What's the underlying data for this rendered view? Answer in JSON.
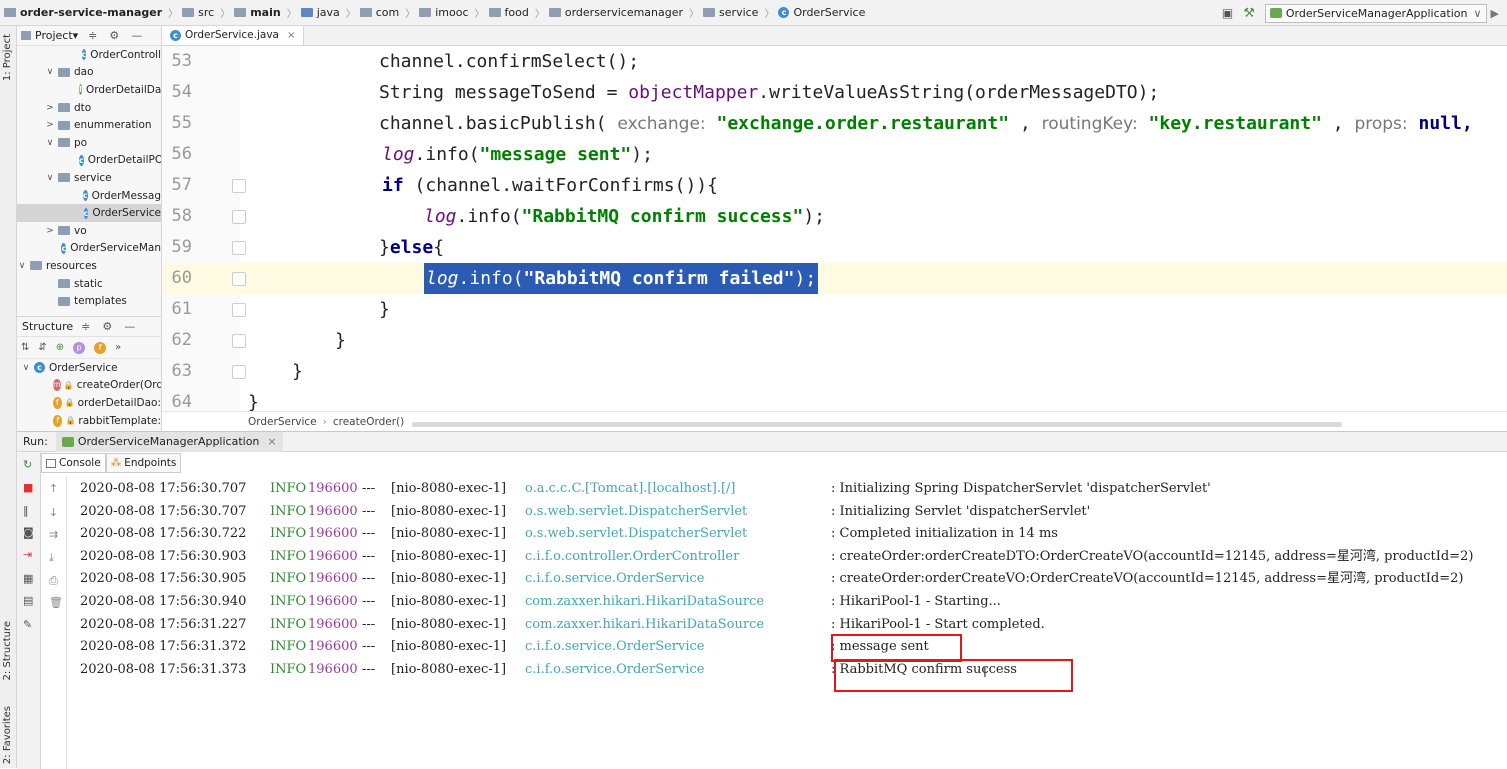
{
  "breadcrumb": {
    "items": [
      {
        "label": "order-service-manager",
        "icon": "module-folder-icon",
        "bold": true
      },
      {
        "label": "src",
        "icon": "folder-icon"
      },
      {
        "label": "main",
        "icon": "folder-icon",
        "bold": true
      },
      {
        "label": "java",
        "icon": "source-folder-icon"
      },
      {
        "label": "com",
        "icon": "folder-icon"
      },
      {
        "label": "imooc",
        "icon": "folder-icon"
      },
      {
        "label": "food",
        "icon": "folder-icon"
      },
      {
        "label": "orderservicemanager",
        "icon": "folder-icon"
      },
      {
        "label": "service",
        "icon": "folder-icon"
      },
      {
        "label": "OrderService",
        "icon": "class-icon"
      }
    ]
  },
  "run_config": {
    "label": "OrderServiceManagerApplication"
  },
  "left_strip": {
    "project_tab": "1: Project",
    "structure_tab": "2: Structure",
    "favorites_tab": "2: Favorites"
  },
  "project_panel": {
    "title": "Project",
    "items": [
      {
        "label": "OrderControll",
        "type": "class",
        "indent": 62,
        "arrow": ""
      },
      {
        "label": "dao",
        "type": "folder",
        "indent": 28,
        "arrow": "∨"
      },
      {
        "label": "OrderDetailDa",
        "type": "interface",
        "indent": 62,
        "arrow": ""
      },
      {
        "label": "dto",
        "type": "folder",
        "indent": 28,
        "arrow": ">"
      },
      {
        "label": "enummeration",
        "type": "folder",
        "indent": 28,
        "arrow": ">"
      },
      {
        "label": "po",
        "type": "folder",
        "indent": 28,
        "arrow": "∨"
      },
      {
        "label": "OrderDetailPO",
        "type": "class",
        "indent": 62,
        "arrow": ""
      },
      {
        "label": "service",
        "type": "folder",
        "indent": 28,
        "arrow": "∨"
      },
      {
        "label": "OrderMessag",
        "type": "class",
        "indent": 62,
        "arrow": ""
      },
      {
        "label": "OrderService",
        "type": "class",
        "indent": 62,
        "arrow": "",
        "selected": true
      },
      {
        "label": "vo",
        "type": "folder",
        "indent": 28,
        "arrow": ">"
      },
      {
        "label": "OrderServiceMan",
        "type": "class",
        "indent": 44,
        "arrow": ""
      },
      {
        "label": "resources",
        "type": "folder",
        "indent": 0,
        "arrow": "∨"
      },
      {
        "label": "static",
        "type": "folder",
        "indent": 28,
        "arrow": ""
      },
      {
        "label": "templates",
        "type": "folder",
        "indent": 28,
        "arrow": ""
      }
    ]
  },
  "structure_panel": {
    "title": "Structure",
    "root": "OrderService",
    "members": [
      {
        "label": "createOrder(Ord",
        "badge": "m",
        "color": "#d66b6b"
      },
      {
        "label": "orderDetailDao:",
        "badge": "f",
        "color": "#e5a12a"
      },
      {
        "label": "rabbitTemplate:",
        "badge": "f",
        "color": "#e5a12a"
      }
    ]
  },
  "editor": {
    "tab_label": "OrderService.java",
    "breadcrumb": [
      "OrderService",
      "createOrder()"
    ],
    "lines": [
      {
        "num": "53"
      },
      {
        "num": "54"
      },
      {
        "num": "55"
      },
      {
        "num": "56"
      },
      {
        "num": "57"
      },
      {
        "num": "58"
      },
      {
        "num": "59"
      },
      {
        "num": "60"
      },
      {
        "num": "61"
      },
      {
        "num": "62"
      },
      {
        "num": "63"
      },
      {
        "num": "64"
      }
    ],
    "code": {
      "l53": "channel.confirmSelect();",
      "l54a": "String messageToSend = ",
      "l54b": "objectMapper",
      "l54c": ".writeValueAsString(orderMessageDTO);",
      "l55a": "channel.basicPublish(",
      "l55h1": "exchange:",
      "l55s1": "\"exchange.order.restaurant\"",
      "l55c1": ",",
      "l55h2": "routingKey:",
      "l55s2": "\"key.restaurant\"",
      "l55c2": ",",
      "l55h3": "props:",
      "l55k": "null,",
      "l56a": "log",
      "l56b": ".info(",
      "l56s": "\"message sent\"",
      "l56c": ");",
      "l57a": "if",
      "l57b": " (channel.waitForConfirms()){",
      "l58a": "log",
      "l58b": ".info(",
      "l58s": "\"RabbitMQ confirm success\"",
      "l58c": ");",
      "l59a": "}",
      "l59b": "else",
      "l59c": "{",
      "l60a": "log",
      "l60b": ".info(",
      "l60s": "\"RabbitMQ confirm failed\"",
      "l60c": ");",
      "l61": "}",
      "l62": "}",
      "l63": "}",
      "l64": "}"
    }
  },
  "run_panel": {
    "label": "Run:",
    "tab": "OrderServiceManagerApplication",
    "console_tab": "Console",
    "endpoints_tab": "Endpoints",
    "log": [
      {
        "time": "2020-08-08 17:56:30.707",
        "level": "INFO",
        "pid": "196600",
        "sep": "---",
        "thread": "[nio-8080-exec-1]",
        "logger": "o.a.c.c.C.[Tomcat].[localhost].[/]",
        "message": ": Initializing Spring DispatcherServlet 'dispatcherServlet'"
      },
      {
        "time": "2020-08-08 17:56:30.707",
        "level": "INFO",
        "pid": "196600",
        "sep": "---",
        "thread": "[nio-8080-exec-1]",
        "logger": "o.s.web.servlet.DispatcherServlet",
        "message": ": Initializing Servlet 'dispatcherServlet'"
      },
      {
        "time": "2020-08-08 17:56:30.722",
        "level": "INFO",
        "pid": "196600",
        "sep": "---",
        "thread": "[nio-8080-exec-1]",
        "logger": "o.s.web.servlet.DispatcherServlet",
        "message": ": Completed initialization in 14 ms"
      },
      {
        "time": "2020-08-08 17:56:30.903",
        "level": "INFO",
        "pid": "196600",
        "sep": "---",
        "thread": "[nio-8080-exec-1]",
        "logger": "c.i.f.o.controller.OrderController",
        "message": ": createOrder:orderCreateDTO:OrderCreateVO(accountId=12145, address=星河湾, productId=2)"
      },
      {
        "time": "2020-08-08 17:56:30.905",
        "level": "INFO",
        "pid": "196600",
        "sep": "---",
        "thread": "[nio-8080-exec-1]",
        "logger": "c.i.f.o.service.OrderService",
        "message": ": createOrder:orderCreateVO:OrderCreateVO(accountId=12145, address=星河湾, productId=2)"
      },
      {
        "time": "2020-08-08 17:56:30.940",
        "level": "INFO",
        "pid": "196600",
        "sep": "---",
        "thread": "[nio-8080-exec-1]",
        "logger": "com.zaxxer.hikari.HikariDataSource",
        "message": ": HikariPool-1 - Starting..."
      },
      {
        "time": "2020-08-08 17:56:31.227",
        "level": "INFO",
        "pid": "196600",
        "sep": "---",
        "thread": "[nio-8080-exec-1]",
        "logger": "com.zaxxer.hikari.HikariDataSource",
        "message": ": HikariPool-1 - Start completed."
      },
      {
        "time": "2020-08-08 17:56:31.372",
        "level": "INFO",
        "pid": "196600",
        "sep": "---",
        "thread": "[nio-8080-exec-1]",
        "logger": "c.i.f.o.service.OrderService",
        "message": ": message sent"
      },
      {
        "time": "2020-08-08 17:56:31.373",
        "level": "INFO",
        "pid": "196600",
        "sep": "---",
        "thread": "[nio-8080-exec-1]",
        "logger": "c.i.f.o.service.OrderService",
        "message": ": RabbitMQ confirm success"
      }
    ]
  },
  "colors": {
    "highlight_box": "#e0191e",
    "selection": "#2a5bb5",
    "logger_text": "#3fa7b5",
    "level_text": "#2e8b2e",
    "pid_text": "#9a3aa0"
  }
}
